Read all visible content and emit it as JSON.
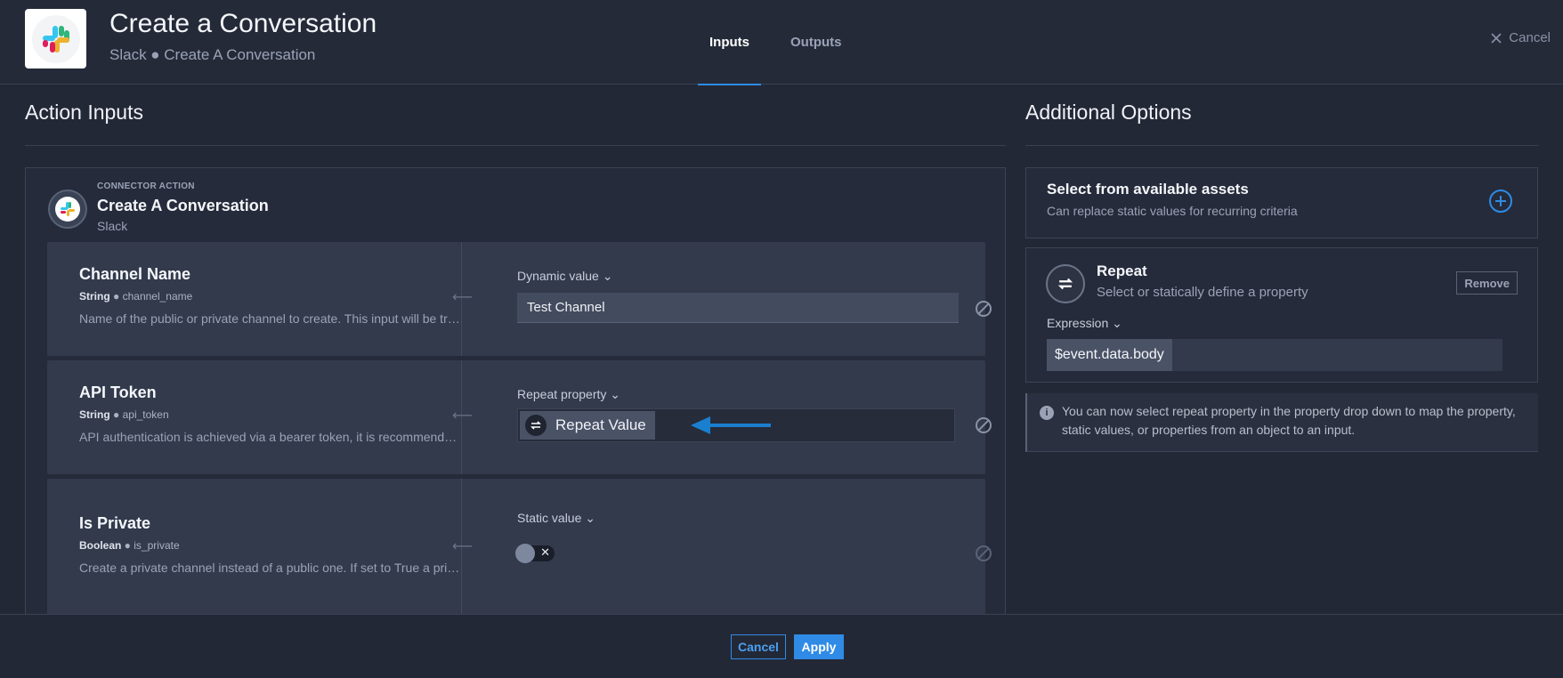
{
  "header": {
    "title": "Create a Conversation",
    "subtitle": "Slack ● Create A Conversation",
    "tabs": [
      {
        "label": "Inputs",
        "active": true
      },
      {
        "label": "Outputs",
        "active": false
      }
    ],
    "cancel_label": "Cancel"
  },
  "action_inputs": {
    "heading": "Action Inputs",
    "connector": {
      "kicker": "CONNECTOR ACTION",
      "title": "Create A Conversation",
      "subtitle": "Slack"
    },
    "fields": [
      {
        "name": "Channel Name",
        "type": "String",
        "key": "channel_name",
        "description": "Name of the public or private channel to create. This input will be transformed to lowercase.",
        "mode": "Dynamic value ⌄",
        "value": "Test Channel"
      },
      {
        "name": "API Token",
        "type": "String",
        "key": "api_token",
        "description": "API authentication is achieved via a bearer token, it is recommended to use an asset.",
        "mode": "Repeat property ⌄",
        "value": "Repeat Value"
      },
      {
        "name": "Is Private",
        "type": "Boolean",
        "key": "is_private",
        "description": "Create a private channel instead of a public one. If set to True a private channel is created.",
        "mode": "Static value ⌄",
        "value": false
      }
    ]
  },
  "additional_options": {
    "heading": "Additional Options",
    "assets": {
      "title": "Select from available assets",
      "subtitle": "Can replace static values for recurring criteria"
    },
    "repeat": {
      "title": "Repeat",
      "subtitle": "Select or statically define a property",
      "remove_label": "Remove",
      "expression_label": "Expression ⌄",
      "expression_value": "$event.data.body"
    },
    "info": "You can now select repeat property in the property drop down to map the property, static values, or properties from an object to an input."
  },
  "footer": {
    "cancel_label": "Cancel",
    "apply_label": "Apply"
  },
  "colors": {
    "accent": "#2f8be6",
    "background": "#232836",
    "row": "#323a4c"
  },
  "icons": [
    "slack-logo-icon",
    "close-icon",
    "arrow-left-icon",
    "repeat-icon",
    "blue-arrow-icon",
    "clear-icon",
    "plus-circle-icon",
    "info-icon",
    "chevron-down-icon"
  ]
}
